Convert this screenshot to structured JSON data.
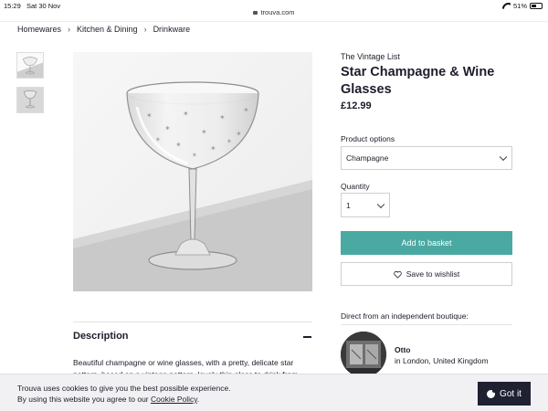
{
  "status_bar": {
    "time": "15:29",
    "date": "Sat 30 Nov",
    "url": "trouva.com",
    "battery": "51%",
    "battery_level": 0.51
  },
  "breadcrumb": [
    "Homewares",
    "Kitchen & Dining",
    "Drinkware"
  ],
  "product": {
    "vendor": "The Vintage List",
    "title": "Star Champagne & Wine Glasses",
    "price": "£12.99"
  },
  "options": {
    "label": "Product options",
    "selected": "Champagne",
    "quantity_label": "Quantity",
    "quantity": "1"
  },
  "actions": {
    "add_to_basket": "Add to basket",
    "save_to_wishlist": "Save to wishlist"
  },
  "boutique": {
    "intro": "Direct from an independent boutique:",
    "name": "Otto",
    "location": "in London, United Kingdom"
  },
  "description": {
    "heading": "Description",
    "text": "Beautiful champagne or wine glasses, with a pretty, delicate star pattern, based on a vintage pattern, lovely thin glass to drink from."
  },
  "cookie": {
    "line1": "Trouva uses cookies to give you the best possible experience.",
    "line2_prefix": "By using this website you agree to our ",
    "policy_link": "Cookie Policy",
    "line2_suffix": ".",
    "button": "Got it"
  },
  "colors": {
    "accent": "#4aa9a2",
    "dark_button": "#1f2032",
    "text": "#1d1d2b"
  },
  "icons": [
    "lock-icon",
    "wifi-icon",
    "battery-icon",
    "chevron-right-icon",
    "chevron-down-icon",
    "heart-icon",
    "minus-icon",
    "cookie-icon"
  ]
}
